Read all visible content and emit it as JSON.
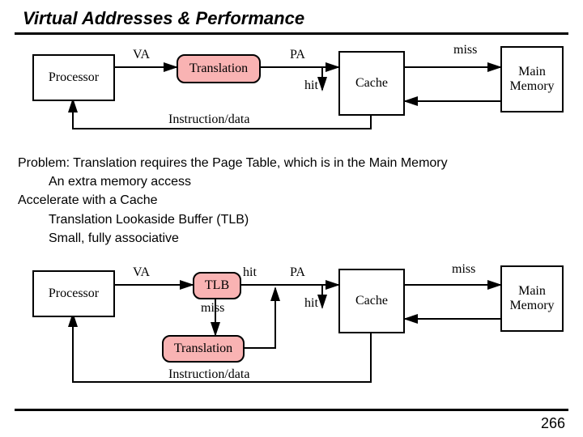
{
  "title": "Virtual Addresses & Performance",
  "page_number": "266",
  "diagram1": {
    "processor": "Processor",
    "translation": "Translation",
    "cache": "Cache",
    "main_memory": "Main\nMemory",
    "va": "VA",
    "pa": "PA",
    "hit": "hit",
    "miss": "miss",
    "instr_data": "Instruction/data"
  },
  "body": {
    "line1": "Problem: Translation requires the Page Table, which is in the Main Memory",
    "line2": "An extra memory access",
    "line3": "Accelerate with a Cache",
    "line4": "Translation Lookaside Buffer (TLB)",
    "line5": "Small, fully associative"
  },
  "diagram2": {
    "processor": "Processor",
    "tlb": "TLB",
    "translation": "Translation",
    "cache": "Cache",
    "main_memory": "Main\nMemory",
    "va": "VA",
    "pa": "PA",
    "hit_tlb": "hit",
    "miss_tlb": "miss",
    "hit_cache": "hit",
    "miss_cache": "miss",
    "instr_data": "Instruction/data"
  }
}
